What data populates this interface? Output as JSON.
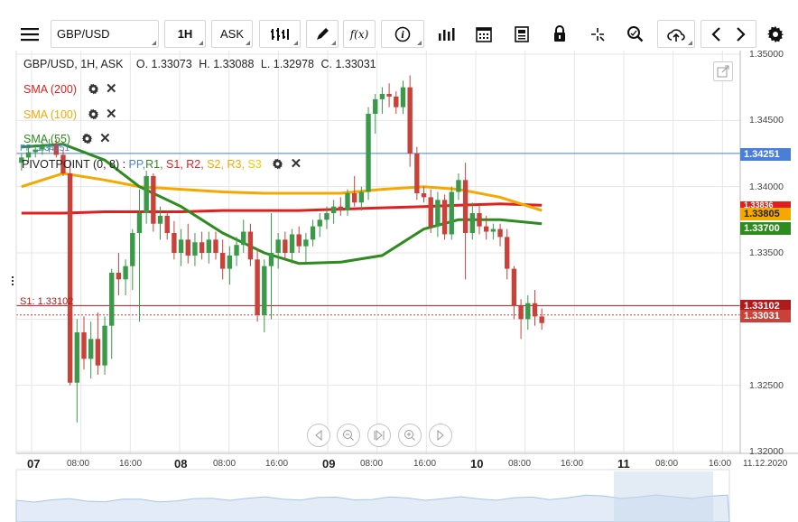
{
  "toolbar": {
    "symbol_value": "GBP/USD",
    "timeframe_label": "1H",
    "price_type_label": "ASK",
    "menu_icon": "hamburger-menu-icon",
    "fx_label": "f(x)"
  },
  "chart": {
    "header": {
      "symbol_line": "GBP/USD, 1H, ASK",
      "open": "O. 1.33073",
      "high": "H. 1.33088",
      "low": "L. 1.32978",
      "close": "C. 1.33031"
    },
    "indicators": [
      {
        "label": "SMA (200)",
        "color": "#e02020"
      },
      {
        "label": "SMA (100)",
        "color": "#f5a800"
      },
      {
        "label": "SMA (55)",
        "color": "#2e8b1e"
      }
    ],
    "pivot": {
      "label": "PIVOTPOINT (0, 8)",
      "sep": " : ",
      "pp": "PP,",
      "r1": "R1,",
      "s1": "S1,",
      "r2": "R2,",
      "s2": "S2,",
      "r3": "R3,",
      "s3": "S3",
      "pp_partial": "PP: 1.34251",
      "s1_line_label": "S1: 1.33102"
    },
    "price_axis": [
      "1.35000",
      "1.34500",
      "1.34000",
      "1.33500",
      "1.33000",
      "1.32500",
      "1.32000"
    ],
    "price_tags": {
      "pp": "1.34251",
      "sma100": "1.33805",
      "sma55": "1.33700",
      "s1": "1.33102",
      "last": "1.33031",
      "sma200_partial": "1.33836"
    },
    "time_axis": [
      {
        "label": "07",
        "big": true
      },
      {
        "label": "08:00",
        "big": false
      },
      {
        "label": "16:00",
        "big": false
      },
      {
        "label": "08",
        "big": true
      },
      {
        "label": "08:00",
        "big": false
      },
      {
        "label": "16:00",
        "big": false
      },
      {
        "label": "09",
        "big": true
      },
      {
        "label": "08:00",
        "big": false
      },
      {
        "label": "16:00",
        "big": false
      },
      {
        "label": "10",
        "big": true
      },
      {
        "label": "08:00",
        "big": false
      },
      {
        "label": "16:00",
        "big": false
      },
      {
        "label": "11",
        "big": true
      },
      {
        "label": "08:00",
        "big": false
      },
      {
        "label": "16:00",
        "big": false
      },
      {
        "label": "11.12.2020",
        "big": false
      }
    ],
    "colors": {
      "up": "#3a9a4a",
      "down": "#c8423a",
      "pp_line": "#4a7fd8",
      "s1_line": "#b01a1a",
      "last_tag": "#c8423a",
      "grid": "#e6e6e6"
    }
  },
  "chart_data": {
    "type": "candlestick",
    "title": "GBP/USD, 1H, ASK",
    "ylim": [
      1.32,
      1.35
    ],
    "x_day_labels": [
      "07",
      "08",
      "09",
      "10",
      "11"
    ],
    "series": [
      {
        "name": "SMA (200)",
        "color": "#e02020"
      },
      {
        "name": "SMA (100)",
        "color": "#f5a800"
      },
      {
        "name": "SMA (55)",
        "color": "#2e8b1e"
      }
    ],
    "candles": [
      [
        1.3418,
        1.3425,
        1.3412,
        1.3422
      ],
      [
        1.3422,
        1.343,
        1.3418,
        1.3426
      ],
      [
        1.3426,
        1.3432,
        1.3422,
        1.3428
      ],
      [
        1.3428,
        1.3434,
        1.3424,
        1.343
      ],
      [
        1.343,
        1.3436,
        1.3426,
        1.3432
      ],
      [
        1.3432,
        1.3436,
        1.3422,
        1.3424
      ],
      [
        1.3424,
        1.3428,
        1.3408,
        1.341
      ],
      [
        1.341,
        1.342,
        1.325,
        1.3252
      ],
      [
        1.3252,
        1.33,
        1.3222,
        1.329
      ],
      [
        1.329,
        1.3302,
        1.3262,
        1.327
      ],
      [
        1.327,
        1.3298,
        1.3255,
        1.3285
      ],
      [
        1.3285,
        1.3305,
        1.3258,
        1.3265
      ],
      [
        1.3265,
        1.3302,
        1.3258,
        1.3295
      ],
      [
        1.3295,
        1.3338,
        1.327,
        1.3335
      ],
      [
        1.3335,
        1.335,
        1.3318,
        1.333
      ],
      [
        1.333,
        1.3345,
        1.3318,
        1.334
      ],
      [
        1.334,
        1.3368,
        1.3322,
        1.3365
      ],
      [
        1.3365,
        1.3398,
        1.3298,
        1.338
      ],
      [
        1.338,
        1.3412,
        1.3372,
        1.3408
      ],
      [
        1.3408,
        1.341,
        1.3366,
        1.3372
      ],
      [
        1.3372,
        1.3385,
        1.336,
        1.3378
      ],
      [
        1.3378,
        1.3382,
        1.336,
        1.3365
      ],
      [
        1.3365,
        1.3374,
        1.3345,
        1.335
      ],
      [
        1.335,
        1.3368,
        1.334,
        1.336
      ],
      [
        1.336,
        1.3372,
        1.3342,
        1.3348
      ],
      [
        1.3348,
        1.3365,
        1.334,
        1.3358
      ],
      [
        1.3358,
        1.3366,
        1.3345,
        1.335
      ],
      [
        1.335,
        1.3366,
        1.3342,
        1.336
      ],
      [
        1.336,
        1.3366,
        1.3345,
        1.335
      ],
      [
        1.335,
        1.336,
        1.333,
        1.3338
      ],
      [
        1.3338,
        1.3355,
        1.3326,
        1.3348
      ],
      [
        1.3348,
        1.3362,
        1.334,
        1.3356
      ],
      [
        1.3356,
        1.3375,
        1.335,
        1.3366
      ],
      [
        1.3366,
        1.3372,
        1.334,
        1.3345
      ],
      [
        1.3345,
        1.3352,
        1.3298,
        1.3303
      ],
      [
        1.3303,
        1.3345,
        1.329,
        1.334
      ],
      [
        1.334,
        1.338,
        1.33,
        1.335
      ],
      [
        1.335,
        1.3365,
        1.3338,
        1.336
      ],
      [
        1.336,
        1.3366,
        1.3345,
        1.335
      ],
      [
        1.335,
        1.3368,
        1.3342,
        1.3364
      ],
      [
        1.3364,
        1.337,
        1.335,
        1.3355
      ],
      [
        1.3355,
        1.3365,
        1.3342,
        1.336
      ],
      [
        1.336,
        1.3375,
        1.3355,
        1.337
      ],
      [
        1.337,
        1.338,
        1.3362,
        1.3375
      ],
      [
        1.3375,
        1.3385,
        1.3368,
        1.338
      ],
      [
        1.338,
        1.339,
        1.3372,
        1.3385
      ],
      [
        1.3385,
        1.3392,
        1.3378,
        1.3382
      ],
      [
        1.3382,
        1.3398,
        1.3378,
        1.3395
      ],
      [
        1.3395,
        1.3408,
        1.3385,
        1.3388
      ],
      [
        1.3388,
        1.34,
        1.3382,
        1.3396
      ],
      [
        1.3396,
        1.346,
        1.339,
        1.3455
      ],
      [
        1.3455,
        1.347,
        1.344,
        1.3466
      ],
      [
        1.3466,
        1.3475,
        1.3455,
        1.347
      ],
      [
        1.347,
        1.3478,
        1.346,
        1.3468
      ],
      [
        1.3468,
        1.3472,
        1.3455,
        1.346
      ],
      [
        1.346,
        1.348,
        1.3455,
        1.3475
      ],
      [
        1.3475,
        1.3484,
        1.3415,
        1.3425
      ],
      [
        1.3425,
        1.343,
        1.339,
        1.3395
      ],
      [
        1.3395,
        1.34,
        1.3388,
        1.3392
      ],
      [
        1.3392,
        1.3398,
        1.3365,
        1.337
      ],
      [
        1.337,
        1.3396,
        1.3362,
        1.339
      ],
      [
        1.339,
        1.3394,
        1.336,
        1.3364
      ],
      [
        1.3364,
        1.34,
        1.336,
        1.3396
      ],
      [
        1.3396,
        1.341,
        1.339,
        1.3405
      ],
      [
        1.3405,
        1.3418,
        1.333,
        1.3365
      ],
      [
        1.3365,
        1.3388,
        1.336,
        1.338
      ],
      [
        1.338,
        1.3386,
        1.3364,
        1.337
      ],
      [
        1.337,
        1.3378,
        1.336,
        1.3366
      ],
      [
        1.3366,
        1.3372,
        1.336,
        1.3368
      ],
      [
        1.3368,
        1.3372,
        1.3355,
        1.3362
      ],
      [
        1.3362,
        1.3368,
        1.333,
        1.3338
      ],
      [
        1.3338,
        1.334,
        1.33,
        1.331
      ],
      [
        1.331,
        1.3315,
        1.3285,
        1.33
      ],
      [
        1.33,
        1.3318,
        1.3292,
        1.3312
      ],
      [
        1.3312,
        1.3322,
        1.3295,
        1.3302
      ],
      [
        1.3302,
        1.3308,
        1.3292,
        1.3297
      ]
    ]
  }
}
